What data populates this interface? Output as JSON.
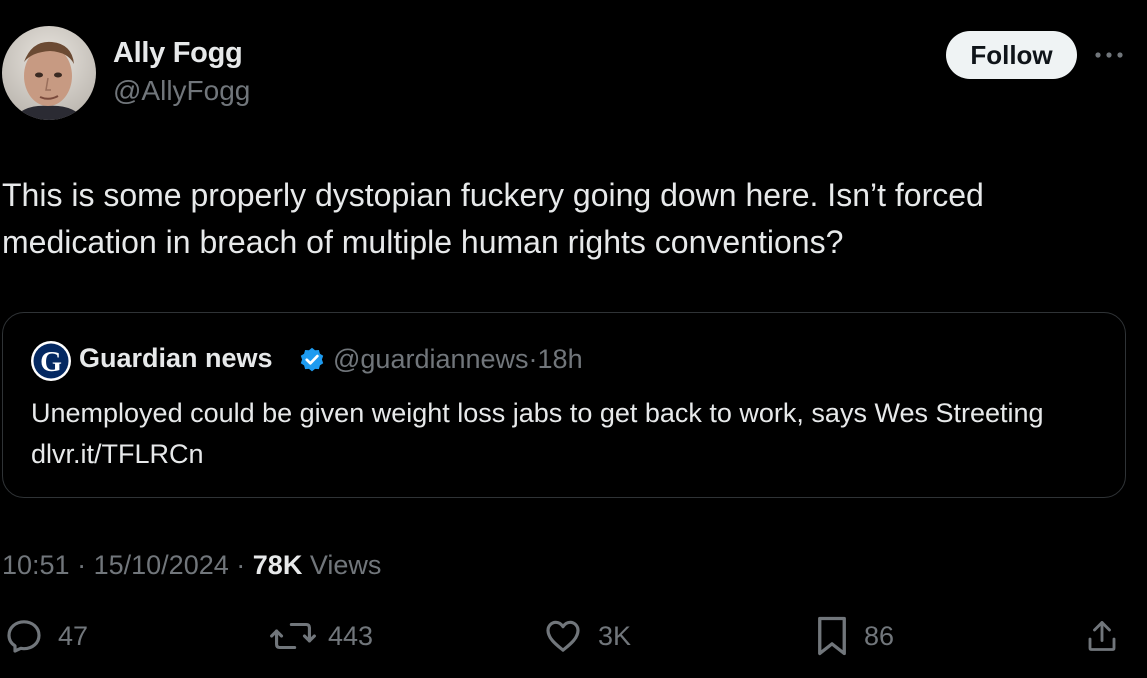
{
  "author": {
    "display_name": "Ally Fogg",
    "handle": "@AllyFogg",
    "avatar_icon": "profile-photo"
  },
  "follow_label": "Follow",
  "more_icon": "more-horizontal-icon",
  "tweet": {
    "text": "This is some properly dystopian fuckery going down here. Isn’t forced medication in breach of multiple human rights conventions?"
  },
  "quote": {
    "name": "Guardian news",
    "handle": "@guardiannews",
    "separator": "·",
    "time": "18h",
    "text": "Unemployed could be given weight loss jabs to get back to work, says Wes Streeting dlvr.it/TFLRCn",
    "logo_icon": "guardian-logo",
    "verified_icon": "verified-badge-icon"
  },
  "meta": {
    "time": "10:51",
    "separator": "·",
    "date": "15/10/2024",
    "views_count": "78K",
    "views_label": "Views"
  },
  "actions": {
    "replies": "47",
    "reposts": "443",
    "likes": "3K",
    "bookmarks": "86"
  },
  "colors": {
    "background": "#000000",
    "text_primary": "#e7e9ea",
    "text_secondary": "#71767b",
    "border": "#2f3336",
    "verified": "#1d9bf0",
    "follow_bg": "#eff3f4"
  }
}
